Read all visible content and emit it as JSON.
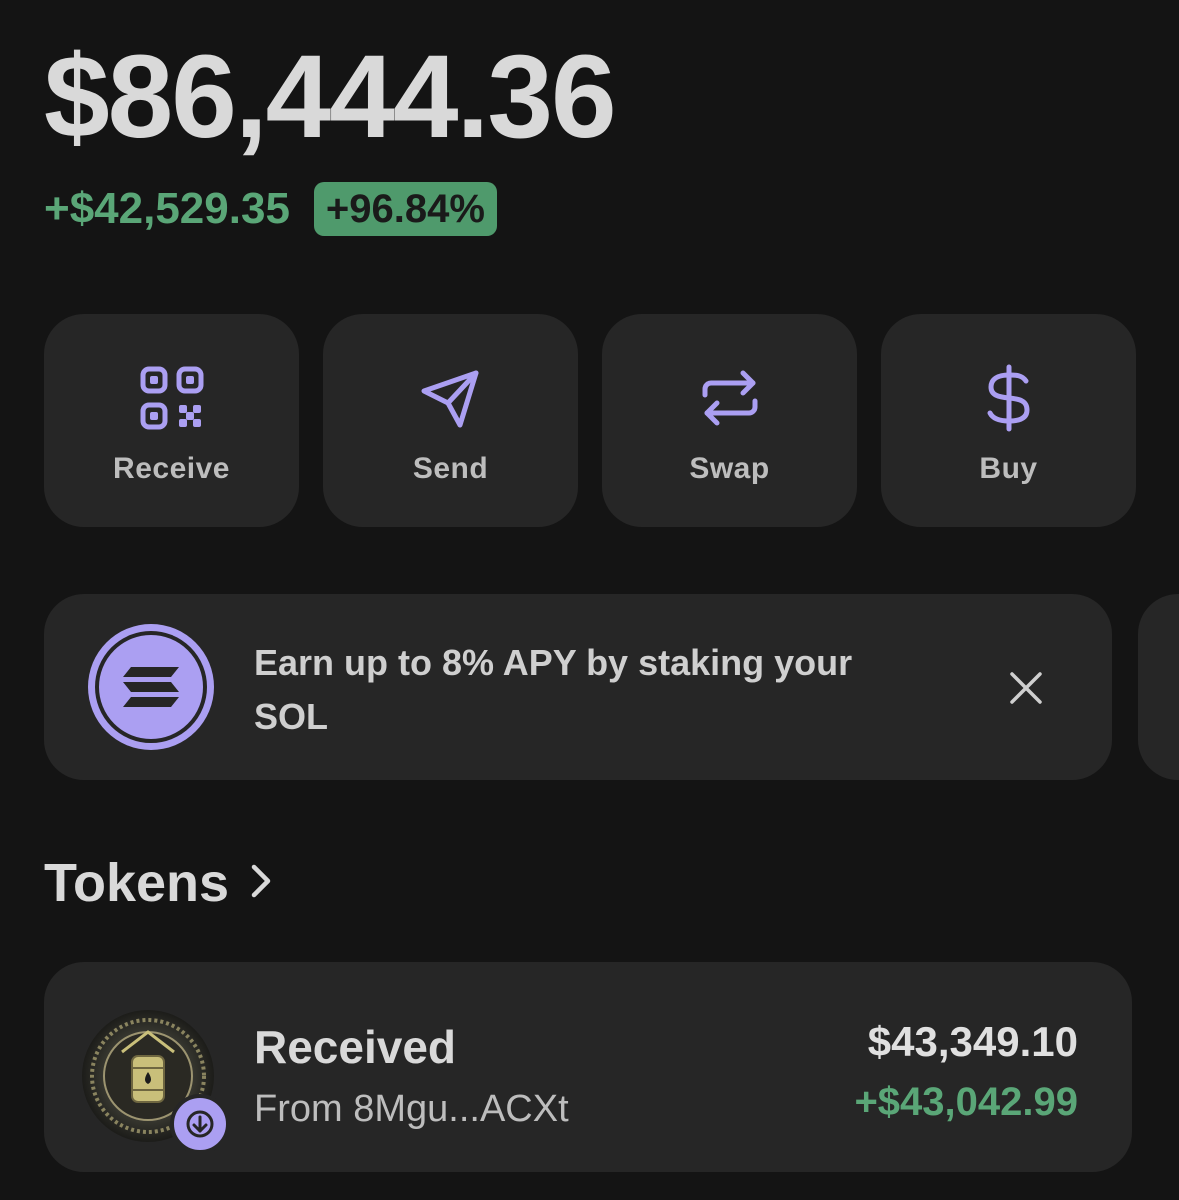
{
  "balance": "$86,444.36",
  "change": {
    "amount": "+$42,529.35",
    "percent": "+96.84%",
    "color": "#5aa677"
  },
  "actions": [
    {
      "label": "Receive",
      "icon": "qr-code-icon"
    },
    {
      "label": "Send",
      "icon": "send-arrow-icon"
    },
    {
      "label": "Swap",
      "icon": "swap-arrows-icon"
    },
    {
      "label": "Buy",
      "icon": "dollar-sign-icon"
    }
  ],
  "accent_color": "#ab9ff2",
  "banner": {
    "text": "Earn up to 8% APY by staking your SOL",
    "icon": "solana-logo-icon",
    "close_icon": "close-icon"
  },
  "tokens": {
    "heading": "Tokens",
    "chevron_icon": "chevron-right-icon"
  },
  "activity": {
    "title": "Received",
    "subtitle": "From 8Mgu...ACXt",
    "value": "$43,349.10",
    "change": "+$43,042.99",
    "badge_icon": "arrow-down-icon",
    "avatar_icon": "token-avatar-icon"
  }
}
